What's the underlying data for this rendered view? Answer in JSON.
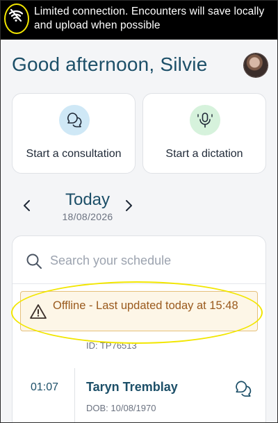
{
  "banner": {
    "message": "Limited connection. Encounters will save locally and upload when possible",
    "icon": "wifi-off-icon",
    "highlight_color": "#f2e600"
  },
  "header": {
    "greeting": "Good afternoon, Silvie",
    "avatar": "user-avatar"
  },
  "actions": [
    {
      "label": "Start a consultation",
      "icon": "chat-bubbles-icon",
      "color": "#cfe8f6"
    },
    {
      "label": "Start a dictation",
      "icon": "microphone-icon",
      "color": "#d6f2dc"
    }
  ],
  "date_nav": {
    "title": "Today",
    "date": "18/08/2026"
  },
  "schedule": {
    "search_placeholder": "Search your schedule",
    "offline_notice": "Offline - Last updated today at 15:48",
    "previous_id": "ID: TP76513",
    "appointment": {
      "time": "01:07",
      "name": "Taryn Tremblay",
      "dob": "DOB: 10/08/1970"
    }
  },
  "colors": {
    "primary": "#1c4f68",
    "warning_text": "#9a5a1d",
    "warning_bg": "#fdf6e7",
    "warning_border": "#e5c07b"
  }
}
